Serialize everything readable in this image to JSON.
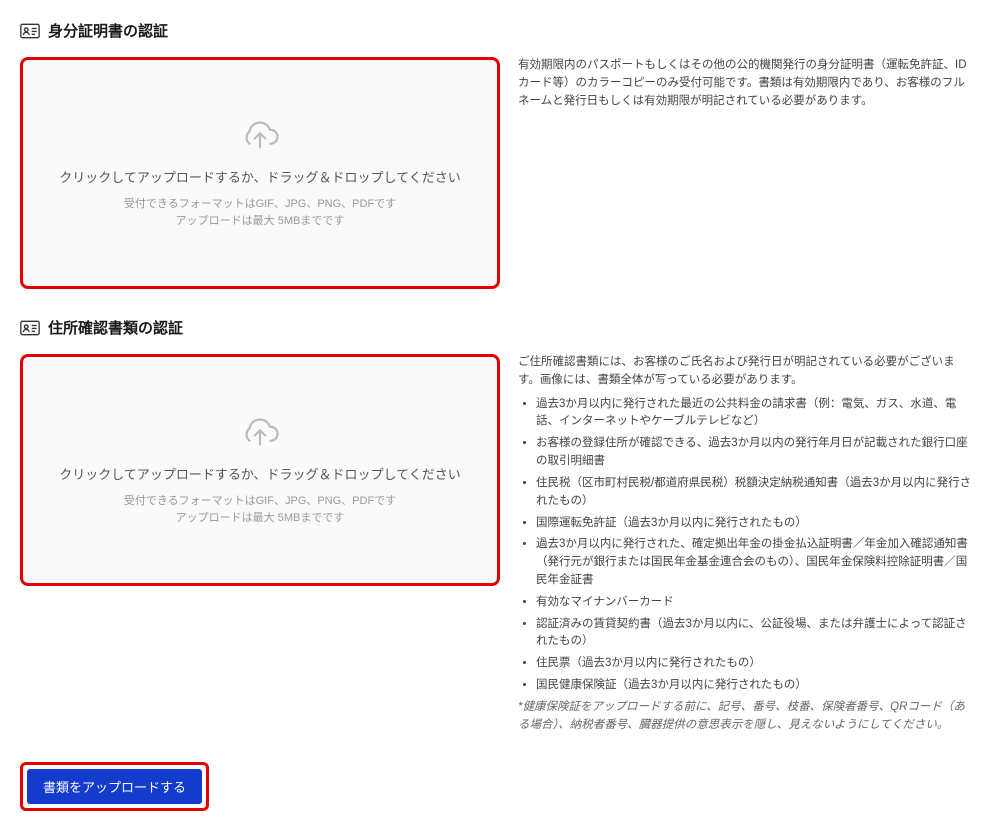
{
  "id_section": {
    "title": "身分証明書の認証",
    "upload_main": "クリックしてアップロードするか、ドラッグ＆ドロップしてください",
    "upload_sub1": "受付できるフォーマットはGIF、JPG、PNG、PDFです",
    "upload_sub2": "アップロードは最大 5MBまでです",
    "info": "有効期限内のパスポートもしくはその他の公的機関発行の身分証明書（運転免許証、IDカード等）のカラーコピーのみ受付可能です。書類は有効期限内であり、お客様のフルネームと発行日もしくは有効期限が明記されている必要があります。"
  },
  "addr_section": {
    "title": "住所確認書類の認証",
    "upload_main": "クリックしてアップロードするか、ドラッグ＆ドロップしてください",
    "upload_sub1": "受付できるフォーマットはGIF、JPG、PNG、PDFです",
    "upload_sub2": "アップロードは最大 5MBまでです",
    "intro": "ご住所確認書類には、お客様のご氏名および発行日が明記されている必要がございます。画像には、書類全体が写っている必要があります。",
    "items": [
      "過去3か月以内に発行された最近の公共料金の請求書（例：電気、ガス、水道、電話、インターネットやケーブルテレビなど）",
      "お客様の登録住所が確認できる、過去3か月以内の発行年月日が記載された銀行口座の取引明細書",
      "住民税（区市町村民税/都道府県民税）税額決定納税通知書（過去3か月以内に発行されたもの）",
      "国際運転免許証（過去3か月以内に発行されたもの）",
      "過去3か月以内に発行された、確定拠出年金の掛金払込証明書／年金加入確認通知書（発行元が銀行または国民年金基金連合会のもの）、国民年金保険料控除証明書／国民年金証書",
      "有効なマイナンバーカード",
      "認証済みの賃貸契約書（過去3か月以内に、公証役場、または弁護士によって認証されたもの）",
      "住民票（過去3か月以内に発行されたもの）",
      "国民健康保険証（過去3か月以内に発行されたもの）"
    ],
    "note": "*健康保険証をアップロードする前に、記号、番号、枝番、保険者番号、QRコード（ある場合）、納税者番号、臓器提供の意思表示を隠し、見えないようにしてください。"
  },
  "submit_label": "書類をアップロードする"
}
